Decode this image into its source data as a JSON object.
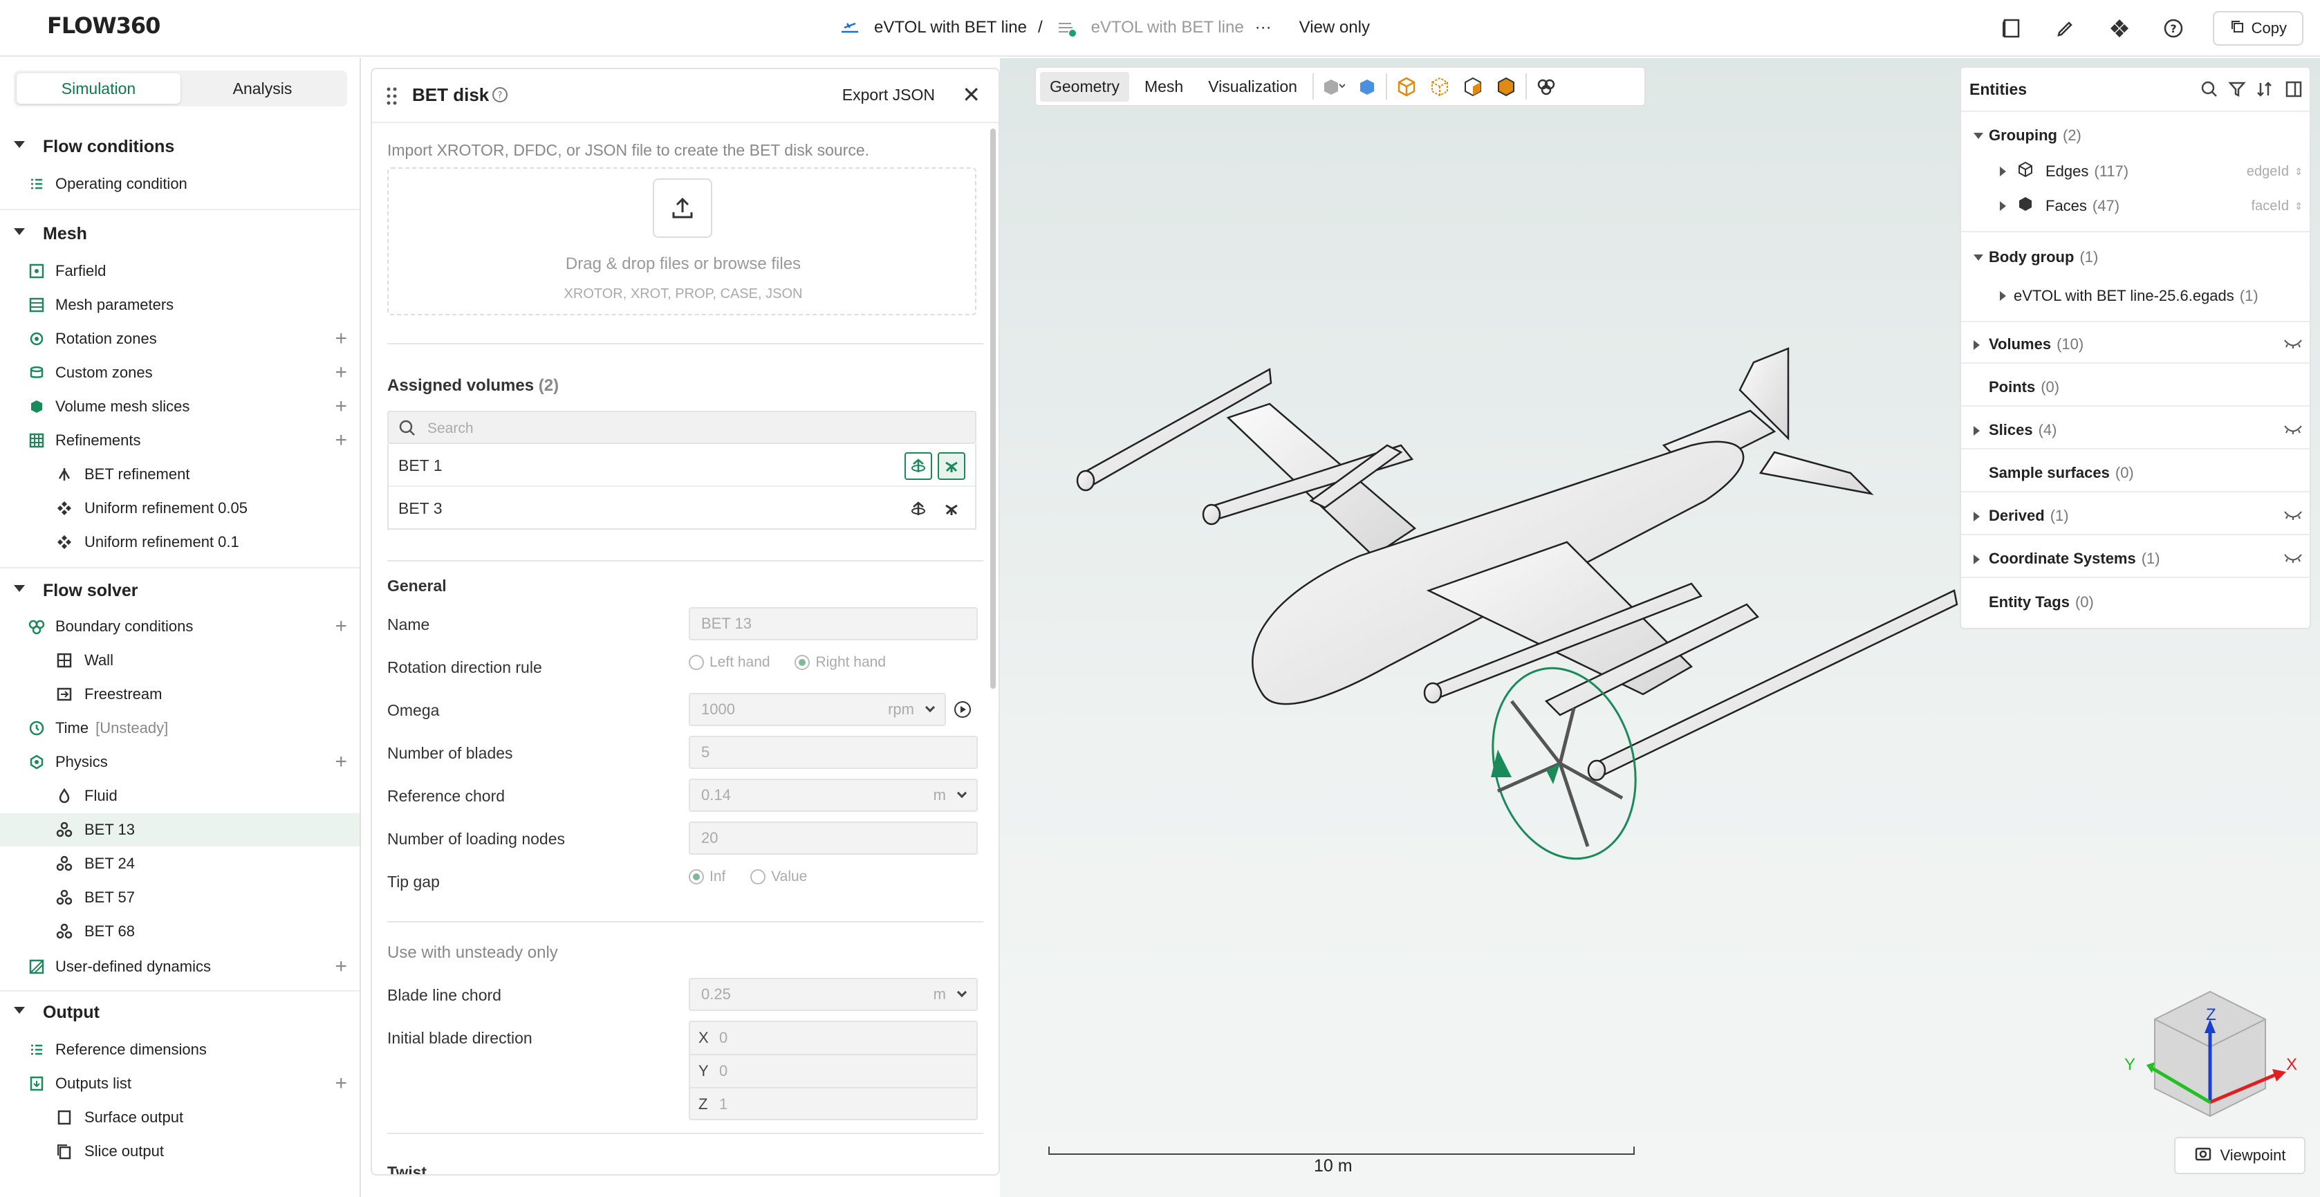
{
  "header": {
    "logo": "FLOW360",
    "project": "eVTOL with BET line",
    "sep": "/",
    "case": "eVTOL with BET line",
    "more": "···",
    "mode": "View only",
    "copy_label": "Copy"
  },
  "left": {
    "tabs": [
      "Simulation",
      "Analysis"
    ],
    "flow_conditions": {
      "title": "Flow conditions",
      "items": [
        "Operating condition"
      ]
    },
    "mesh": {
      "title": "Mesh",
      "items": [
        "Farfield",
        "Mesh parameters",
        "Rotation zones",
        "Custom zones",
        "Volume mesh slices",
        "Refinements"
      ],
      "refinements": [
        "BET refinement",
        "Uniform refinement 0.05",
        "Uniform refinement 0.1"
      ]
    },
    "flow_solver": {
      "title": "Flow solver",
      "boundary": "Boundary conditions",
      "bc_items": [
        "Wall",
        "Freestream"
      ],
      "time": "Time",
      "time_tag": "[Unsteady]",
      "physics": "Physics",
      "physics_items": [
        "Fluid",
        "BET 13",
        "BET 24",
        "BET 57",
        "BET 68"
      ],
      "udd": "User-defined dynamics"
    },
    "output": {
      "title": "Output",
      "items": [
        "Reference dimensions",
        "Outputs list"
      ],
      "outputs": [
        "Surface output",
        "Slice output"
      ]
    }
  },
  "panel": {
    "title": "BET disk",
    "export": "Export JSON",
    "import_hint": "Import XROTOR, DFDC, or JSON file to create the BET disk source.",
    "drop_text": "Drag & drop files or browse files",
    "drop_formats": "XROTOR, XROT, PROP, CASE, JSON",
    "assigned_title": "Assigned volumes",
    "assigned_count": "(2)",
    "search_placeholder": "Search",
    "volumes": [
      "BET 1",
      "BET 3"
    ],
    "general": "General",
    "fields": {
      "name_label": "Name",
      "name_val": "BET 13",
      "rot_label": "Rotation direction rule",
      "left_hand": "Left hand",
      "right_hand": "Right hand",
      "omega_label": "Omega",
      "omega_val": "1000",
      "omega_unit": "rpm",
      "blades_label": "Number of blades",
      "blades_val": "5",
      "chord_label": "Reference chord",
      "chord_val": "0.14",
      "chord_unit": "m",
      "nodes_label": "Number of loading nodes",
      "nodes_val": "20",
      "tip_label": "Tip gap",
      "tip_inf": "Inf",
      "tip_value": "Value"
    },
    "unsteady": "Use with unsteady only",
    "blade_chord_label": "Blade line chord",
    "blade_chord_val": "0.25",
    "blade_chord_unit": "m",
    "init_dir_label": "Initial blade direction",
    "x": "X",
    "y": "Y",
    "z": "Z",
    "xv": "0",
    "yv": "0",
    "zv": "1",
    "twist": "Twist"
  },
  "toolbar": {
    "tabs": [
      "Geometry",
      "Mesh",
      "Visualization"
    ]
  },
  "entities": {
    "title": "Entities",
    "grouping": "Grouping",
    "grouping_c": "(2)",
    "edges": "Edges",
    "edges_c": "(117)",
    "edges_tag": "edgeId",
    "faces": "Faces",
    "faces_c": "(47)",
    "faces_tag": "faceId",
    "body": "Body group",
    "body_c": "(1)",
    "body_item": "eVTOL with BET line-25.6.egads",
    "body_item_c": "(1)",
    "volumes": "Volumes",
    "volumes_c": "(10)",
    "points": "Points",
    "points_c": "(0)",
    "slices": "Slices",
    "slices_c": "(4)",
    "sample": "Sample surfaces",
    "sample_c": "(0)",
    "derived": "Derived",
    "derived_c": "(1)",
    "coords": "Coordinate Systems",
    "coords_c": "(1)",
    "tags": "Entity Tags",
    "tags_c": "(0)"
  },
  "viewport": {
    "scale": "10 m",
    "viewpoint": "Viewpoint",
    "axes": {
      "x": "X",
      "y": "Y",
      "z": "Z"
    }
  },
  "colors": {
    "accent": "#0f7a47",
    "green": "#1a8a5a"
  }
}
